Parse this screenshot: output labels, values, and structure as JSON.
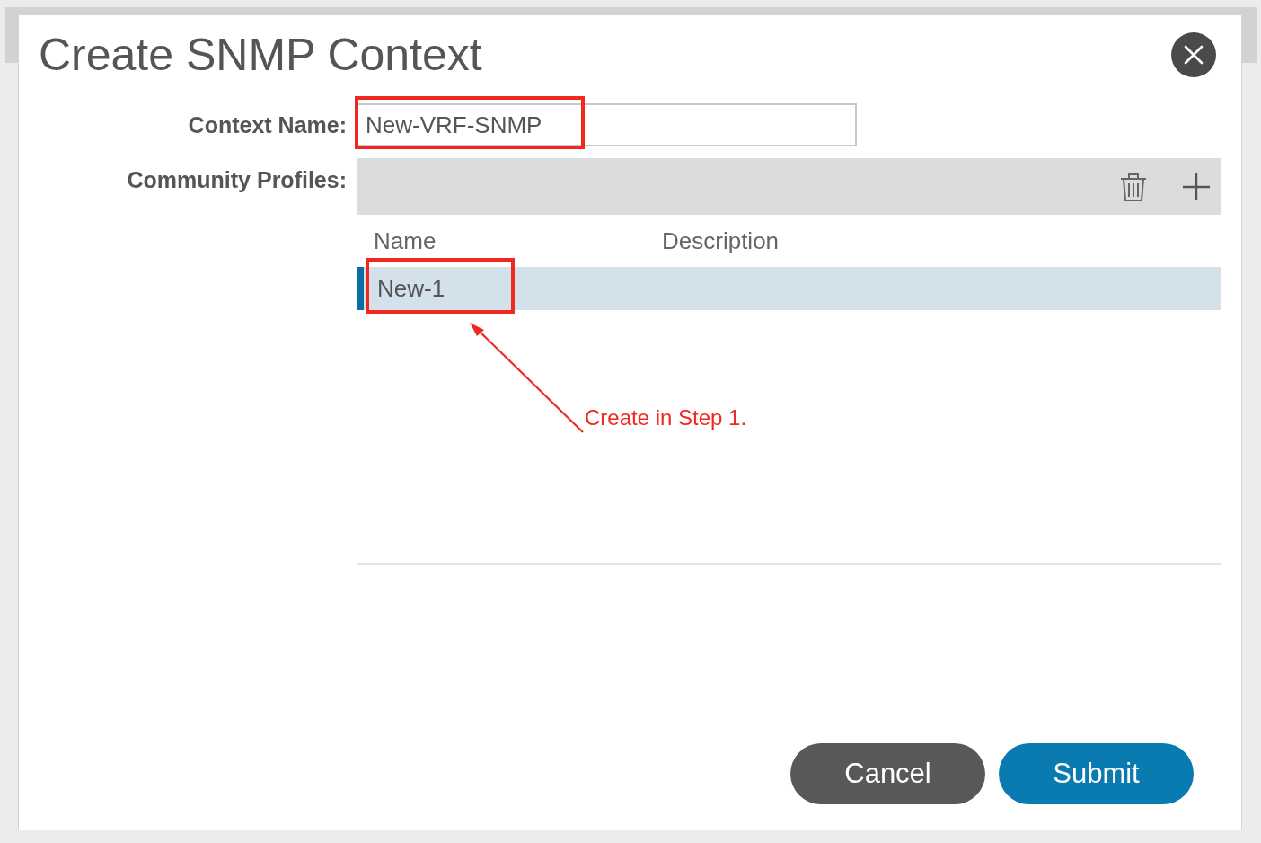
{
  "dialog": {
    "title": "Create SNMP Context"
  },
  "context_name": {
    "label": "Context Name:",
    "value": "New-VRF-SNMP",
    "highlighted": true
  },
  "community_profiles": {
    "label": "Community Profiles:",
    "columns": [
      "Name",
      "Description"
    ],
    "rows": [
      {
        "name": "New-1",
        "selected": true,
        "highlighted": true
      }
    ]
  },
  "annotation": {
    "text": "Create in Step 1."
  },
  "buttons": [
    {
      "label": "Cancel",
      "kind": "secondary"
    },
    {
      "label": "Submit",
      "kind": "primary"
    }
  ]
}
